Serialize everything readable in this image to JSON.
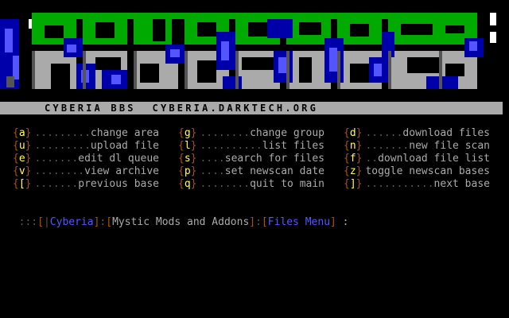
{
  "colors": {
    "background": "#000000",
    "bar_gray": "#aaaaaa",
    "bracket_brown": "#aa5500",
    "key_yellow": "#ffff55",
    "dots_darkgray": "#555555",
    "label_lightgray": "#aaaaaa",
    "highlight_blue": "#5555ff",
    "logo_green": "#00aa00",
    "logo_blue": "#0000aa"
  },
  "banner": {
    "logo_text": "FILES!",
    "logo_icon": "ansi-block-art-logo"
  },
  "title_bar": {
    "text": "CYBERIA BBS  CYBERIA.DARKTECH.ORG"
  },
  "menu": {
    "columns": [
      {
        "items": [
          {
            "key": "a",
            "dots": ".........",
            "label": "change area"
          },
          {
            "key": "u",
            "dots": ".........",
            "label": "upload file"
          },
          {
            "key": "e",
            "dots": ".......",
            "label": "edit dl queue"
          },
          {
            "key": "v",
            "dots": "........",
            "label": "view archive"
          },
          {
            "key": "[",
            "dots": ".......",
            "label": "previous base"
          }
        ]
      },
      {
        "items": [
          {
            "key": "g",
            "dots": "........",
            "label": "change group"
          },
          {
            "key": "l",
            "dots": "..........",
            "label": "list files"
          },
          {
            "key": "s",
            "dots": "....",
            "label": "search for files"
          },
          {
            "key": "p",
            "dots": "....",
            "label": "set newscan date"
          },
          {
            "key": "q",
            "dots": "........",
            "label": "quit to main"
          }
        ]
      },
      {
        "items": [
          {
            "key": "d",
            "dots": "......",
            "label": "download files"
          },
          {
            "key": "n",
            "dots": ".......",
            "label": "new file scan"
          },
          {
            "key": "f",
            "dots": "..",
            "label": "download file list"
          },
          {
            "key": "z",
            "dots": "",
            "label": "toggle newscan bases"
          },
          {
            "key": "]",
            "dots": "...........",
            "label": "next base"
          }
        ]
      }
    ]
  },
  "prompt": {
    "prefix": ":::",
    "bbs_name": "Cyberia",
    "section": "Mystic Mods and Addons",
    "menu_name": "Files Menu",
    "suffix": " :"
  }
}
